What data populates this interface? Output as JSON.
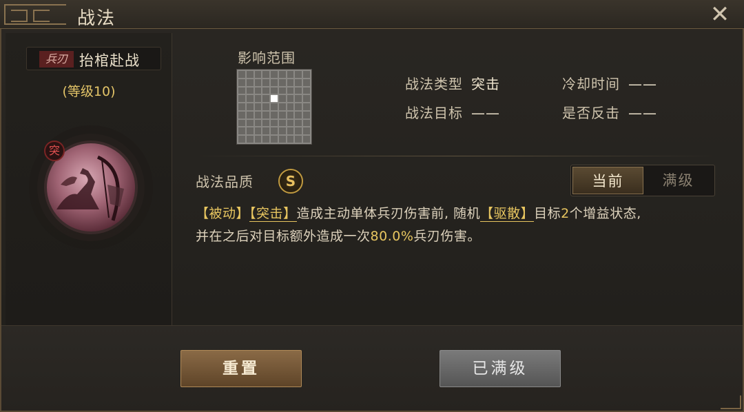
{
  "window": {
    "title": "战法",
    "close_icon": "close-icon"
  },
  "skill": {
    "type_tag": "兵刃",
    "name": "抬棺赴战",
    "level": "(等级10)",
    "badge": "突",
    "portrait_icon": "cavalry-archer-icon"
  },
  "range": {
    "label": "影响范围",
    "grid_size": 9,
    "cells": [
      "",
      "",
      "",
      "",
      "",
      "",
      "",
      "",
      "",
      "",
      "",
      "",
      "",
      "",
      "",
      "",
      "",
      "",
      "",
      "",
      "",
      "",
      "",
      "",
      "",
      "",
      "",
      "",
      "",
      "",
      "",
      "self",
      "",
      "",
      "",
      "",
      "",
      "",
      "",
      "",
      "",
      "",
      "",
      "",
      "",
      "",
      "",
      "",
      "",
      "",
      "",
      "",
      "",
      "",
      "",
      "",
      "",
      "",
      "",
      "",
      "",
      "",
      "",
      "",
      "",
      "",
      "",
      "",
      "",
      "",
      "",
      "",
      "",
      "",
      "",
      "",
      "",
      "",
      "",
      "",
      ""
    ]
  },
  "attributes": {
    "type_label": "战法类型",
    "type_value": "突击",
    "target_label": "战法目标",
    "target_value": "——",
    "cooldown_label": "冷却时间",
    "cooldown_value": "——",
    "counter_label": "是否反击",
    "counter_value": "——"
  },
  "quality": {
    "label": "战法品质",
    "grade": "S"
  },
  "toggle": {
    "current": "当前",
    "max": "满级",
    "active": "current"
  },
  "description": {
    "p1": "【被动】",
    "p2": "【突击】",
    "p3": "造成主动单体兵刃伤害前, 随机",
    "p4": "【驱散】",
    "p5": "目标",
    "p6": "2",
    "p7": "个增益状态,",
    "p8": "并在之后对目标额外造成一次",
    "p9": "80.0%",
    "p10": "兵刃伤害。"
  },
  "buttons": {
    "reset": "重置",
    "maxed": "已满级"
  },
  "colors": {
    "accent_gold": "#e8c660",
    "quality_gold": "#c09a40",
    "type_red": "#5a2020"
  }
}
